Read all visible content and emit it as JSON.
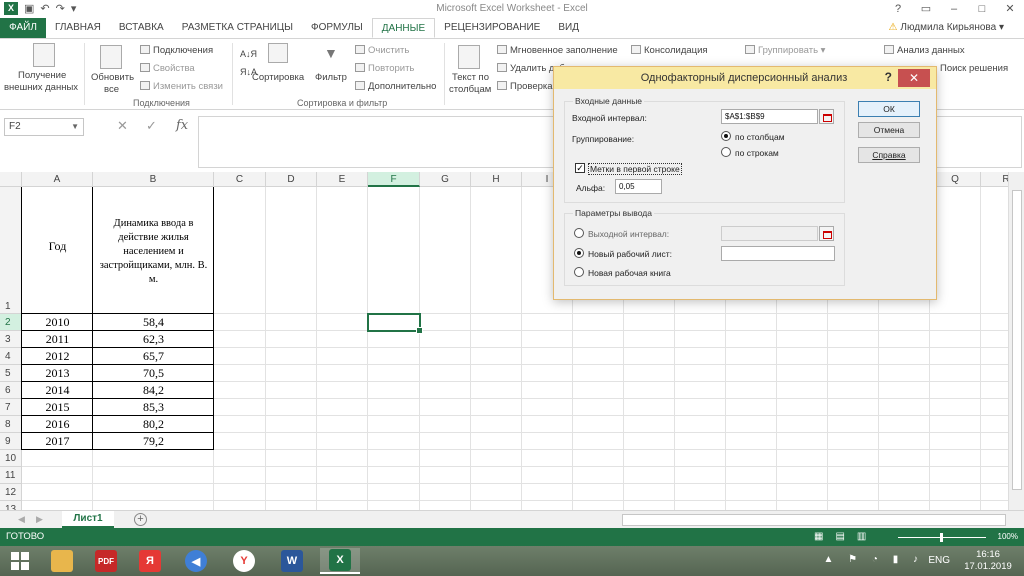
{
  "window": {
    "title": "Microsoft Excel Worksheet - Excel",
    "user": "Людмила Кирьянова"
  },
  "tabs": [
    "ФАЙЛ",
    "ГЛАВНАЯ",
    "ВСТАВКА",
    "РАЗМЕТКА СТРАНИЦЫ",
    "ФОРМУЛЫ",
    "ДАННЫЕ",
    "РЕЦЕНЗИРОВАНИЕ",
    "ВИД"
  ],
  "active_tab": "ДАННЫЕ",
  "ribbon": {
    "get_external_1": "Получение",
    "get_external_2": "внешних данных",
    "refresh_1": "Обновить",
    "refresh_2": "все",
    "connections": "Подключения",
    "properties": "Свойства",
    "edit_links": "Изменить связи",
    "group_connections": "Подключения",
    "sort": "Сортировка",
    "filter": "Фильтр",
    "clear": "Очистить",
    "reapply": "Повторить",
    "advanced": "Дополнительно",
    "group_sort": "Сортировка и фильтр",
    "text_to_cols_1": "Текст по",
    "text_to_cols_2": "столбцам",
    "flash_fill": "Мгновенное заполнение",
    "remove_dup": "Удалить дубликаты",
    "validation": "Проверка",
    "consolidate": "Консолидация",
    "group": "Группировать",
    "data_analysis": "Анализ данных",
    "solver": "Поиск решения"
  },
  "formula_bar": {
    "name_box": "F2",
    "formula": ""
  },
  "columns": [
    "A",
    "B",
    "C",
    "D",
    "E",
    "F",
    "G",
    "H",
    "I",
    "J",
    "K",
    "L",
    "M",
    "N",
    "O",
    "P",
    "Q",
    "R"
  ],
  "rows": [
    "1",
    "2",
    "3",
    "4",
    "5",
    "6",
    "7",
    "8",
    "9",
    "10",
    "11",
    "12",
    "13"
  ],
  "table": {
    "header_year": "Год",
    "header_value": "Динамика ввода в действие жилья населением и застройщиками, млн. В. м.",
    "data": [
      {
        "year": "2010",
        "value": "58,4"
      },
      {
        "year": "2011",
        "value": "62,3"
      },
      {
        "year": "2012",
        "value": "65,7"
      },
      {
        "year": "2013",
        "value": "70,5"
      },
      {
        "year": "2014",
        "value": "84,2"
      },
      {
        "year": "2015",
        "value": "85,3"
      },
      {
        "year": "2016",
        "value": "80,2"
      },
      {
        "year": "2017",
        "value": "79,2"
      }
    ]
  },
  "sheet_tab": "Лист1",
  "status": {
    "ready": "ГОТОВО",
    "zoom": "100%"
  },
  "tray": {
    "lang": "ENG",
    "time": "16:16",
    "date": "17.01.2019"
  },
  "dialog": {
    "title": "Однофакторный дисперсионный анализ",
    "input_section": "Входные данные",
    "input_range_label": "Входной интервал:",
    "input_range_value": "$A$1:$B$9",
    "grouping_label": "Группирование:",
    "by_columns": "по столбцам",
    "by_rows": "по строкам",
    "labels_first_row": "Метки в первой строке",
    "alpha_label": "Альфа:",
    "alpha_value": "0,05",
    "output_section": "Параметры вывода",
    "output_range": "Выходной интервал:",
    "new_worksheet": "Новый рабочий лист:",
    "new_workbook": "Новая рабочая книга",
    "ok": "ОК",
    "cancel": "Отмена",
    "help": "Справка"
  }
}
